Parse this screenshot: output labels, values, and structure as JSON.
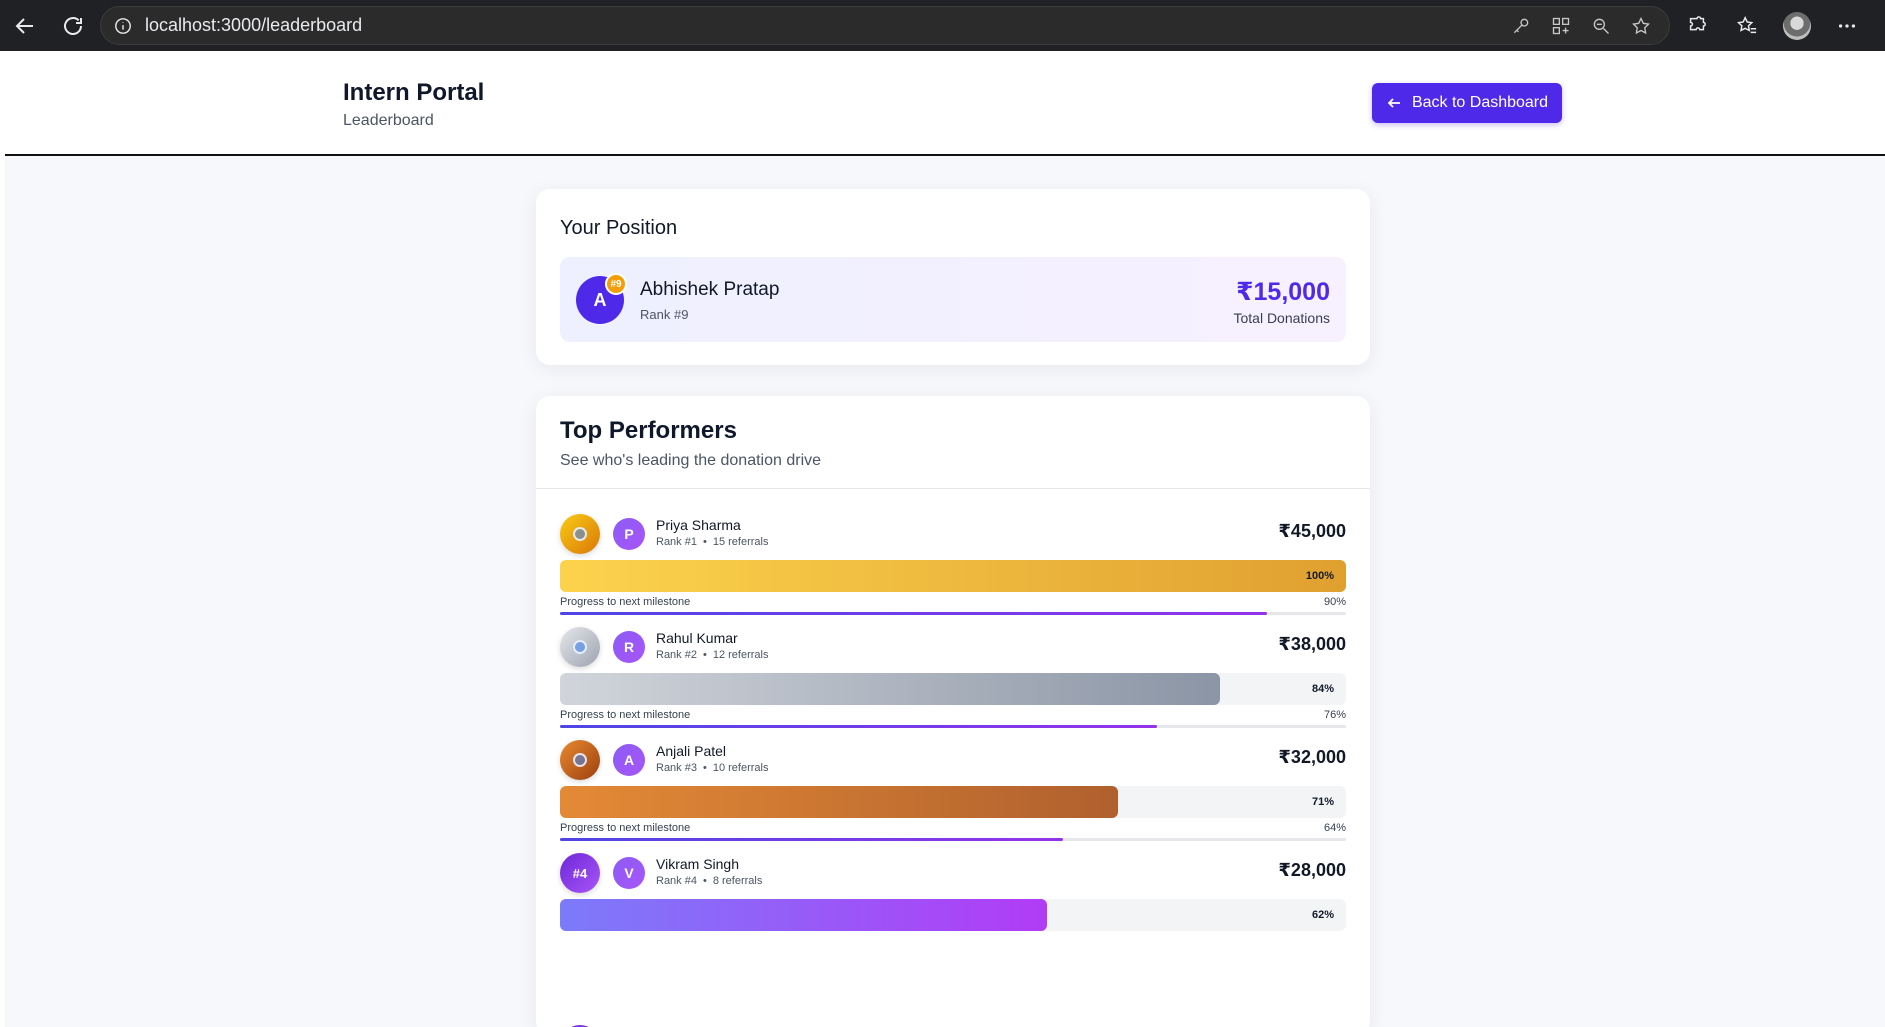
{
  "browser": {
    "url": "localhost:3000/leaderboard"
  },
  "header": {
    "title": "Intern Portal",
    "subtitle": "Leaderboard",
    "back_label": "Back to Dashboard"
  },
  "position": {
    "title": "Your Position",
    "avatar_initial": "A",
    "badge": "#9",
    "name": "Abhishek Pratap",
    "rank": "Rank #9",
    "amount": "₹15,000",
    "amount_label": "Total Donations"
  },
  "top_performers": {
    "title": "Top Performers",
    "subtitle": "See who's leading the donation drive",
    "milestone_label": "Progress to next milestone",
    "separator": "•",
    "rows": [
      {
        "medal": "",
        "initial": "P",
        "name": "Priya Sharma",
        "rank": "Rank #1",
        "referrals": "15 referrals",
        "amount": "₹45,000",
        "bar_pct": "100%",
        "bar_value": 100,
        "milestone_pct": "90%",
        "milestone_value": 90
      },
      {
        "medal": "",
        "initial": "R",
        "name": "Rahul Kumar",
        "rank": "Rank #2",
        "referrals": "12 referrals",
        "amount": "₹38,000",
        "bar_pct": "84%",
        "bar_value": 84,
        "milestone_pct": "76%",
        "milestone_value": 76
      },
      {
        "medal": "",
        "initial": "A",
        "name": "Anjali Patel",
        "rank": "Rank #3",
        "referrals": "10 referrals",
        "amount": "₹32,000",
        "bar_pct": "71%",
        "bar_value": 71,
        "milestone_pct": "64%",
        "milestone_value": 64
      },
      {
        "medal": "#4",
        "initial": "V",
        "name": "Vikram Singh",
        "rank": "Rank #4",
        "referrals": "8 referrals",
        "amount": "₹28,000",
        "bar_pct": "62%",
        "bar_value": 62
      }
    ]
  },
  "colors": {
    "accent": "#4f29ea",
    "gold": "#e0a030",
    "silver": "#8b95a5",
    "bronze": "#b0602e",
    "purple": "#b13cf6"
  }
}
